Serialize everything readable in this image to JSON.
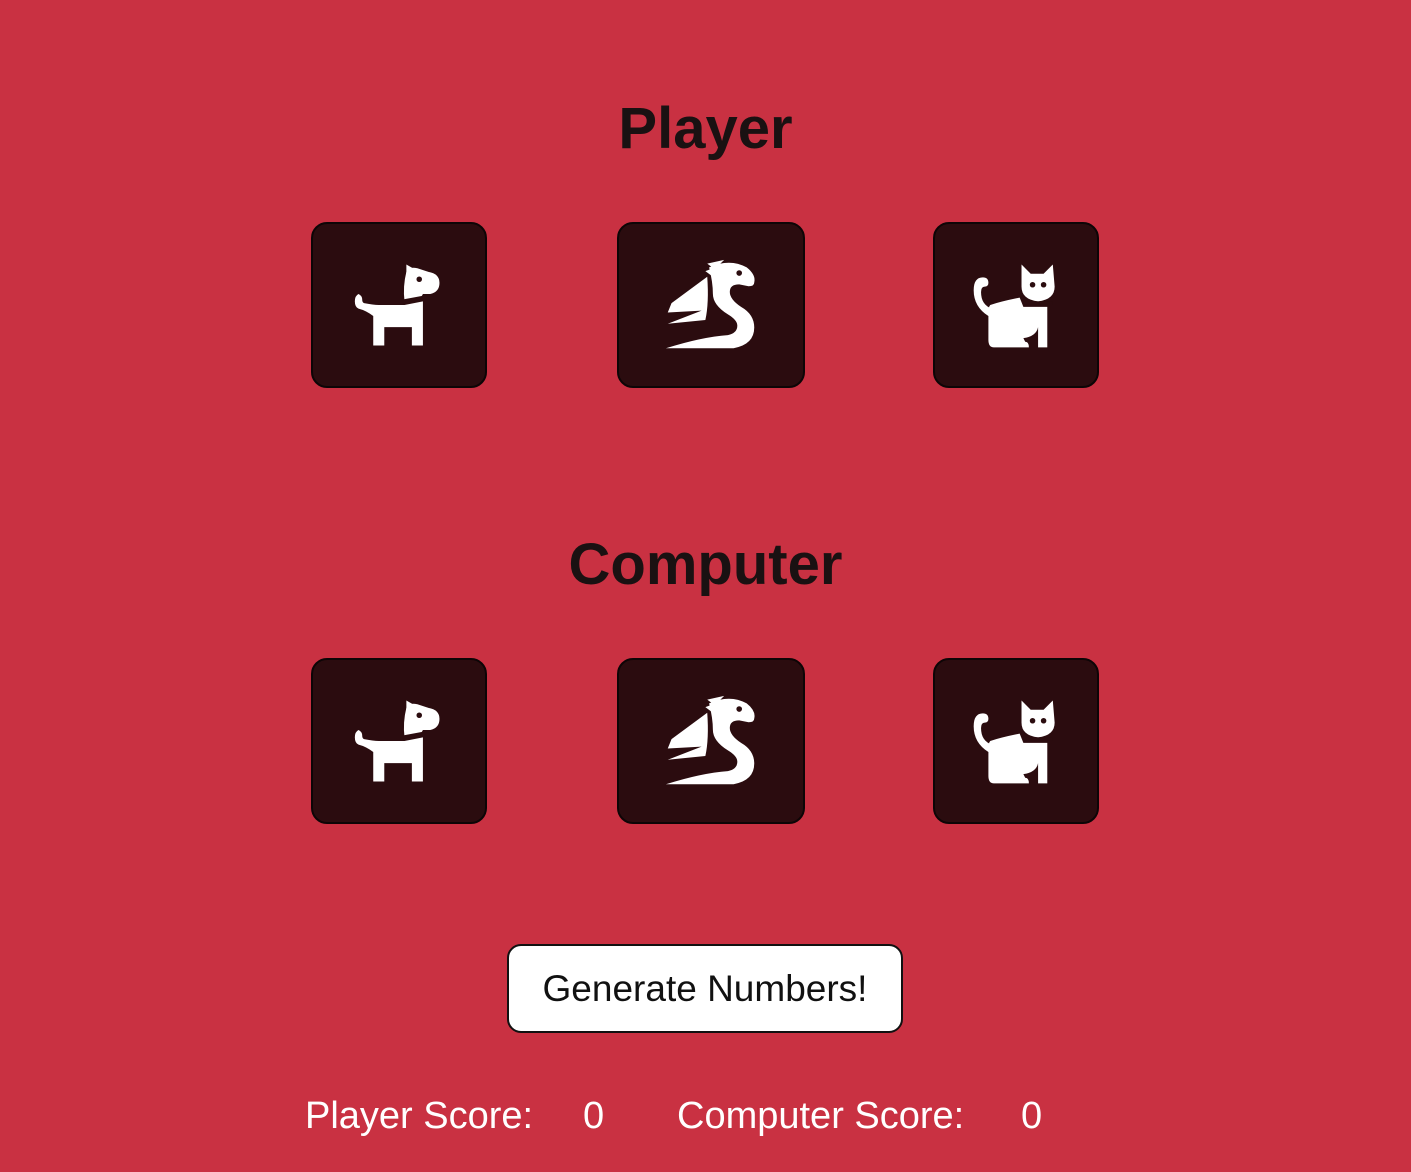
{
  "player_section": {
    "title": "Player",
    "choices": [
      {
        "name": "dog",
        "icon": "dog-icon"
      },
      {
        "name": "dragon",
        "icon": "dragon-icon"
      },
      {
        "name": "cat",
        "icon": "cat-icon"
      }
    ]
  },
  "computer_section": {
    "title": "Computer",
    "choices": [
      {
        "name": "dog",
        "icon": "dog-icon"
      },
      {
        "name": "dragon",
        "icon": "dragon-icon"
      },
      {
        "name": "cat",
        "icon": "cat-icon"
      }
    ]
  },
  "generate_button": {
    "label": "Generate Numbers!"
  },
  "scores": {
    "player_label": "Player Score:",
    "player_value": "0",
    "computer_label": "Computer Score:",
    "computer_value": "0"
  },
  "colors": {
    "background": "#c93142",
    "card": "#2b0c0f",
    "icon": "#ffffff",
    "heading": "#1a1112"
  }
}
